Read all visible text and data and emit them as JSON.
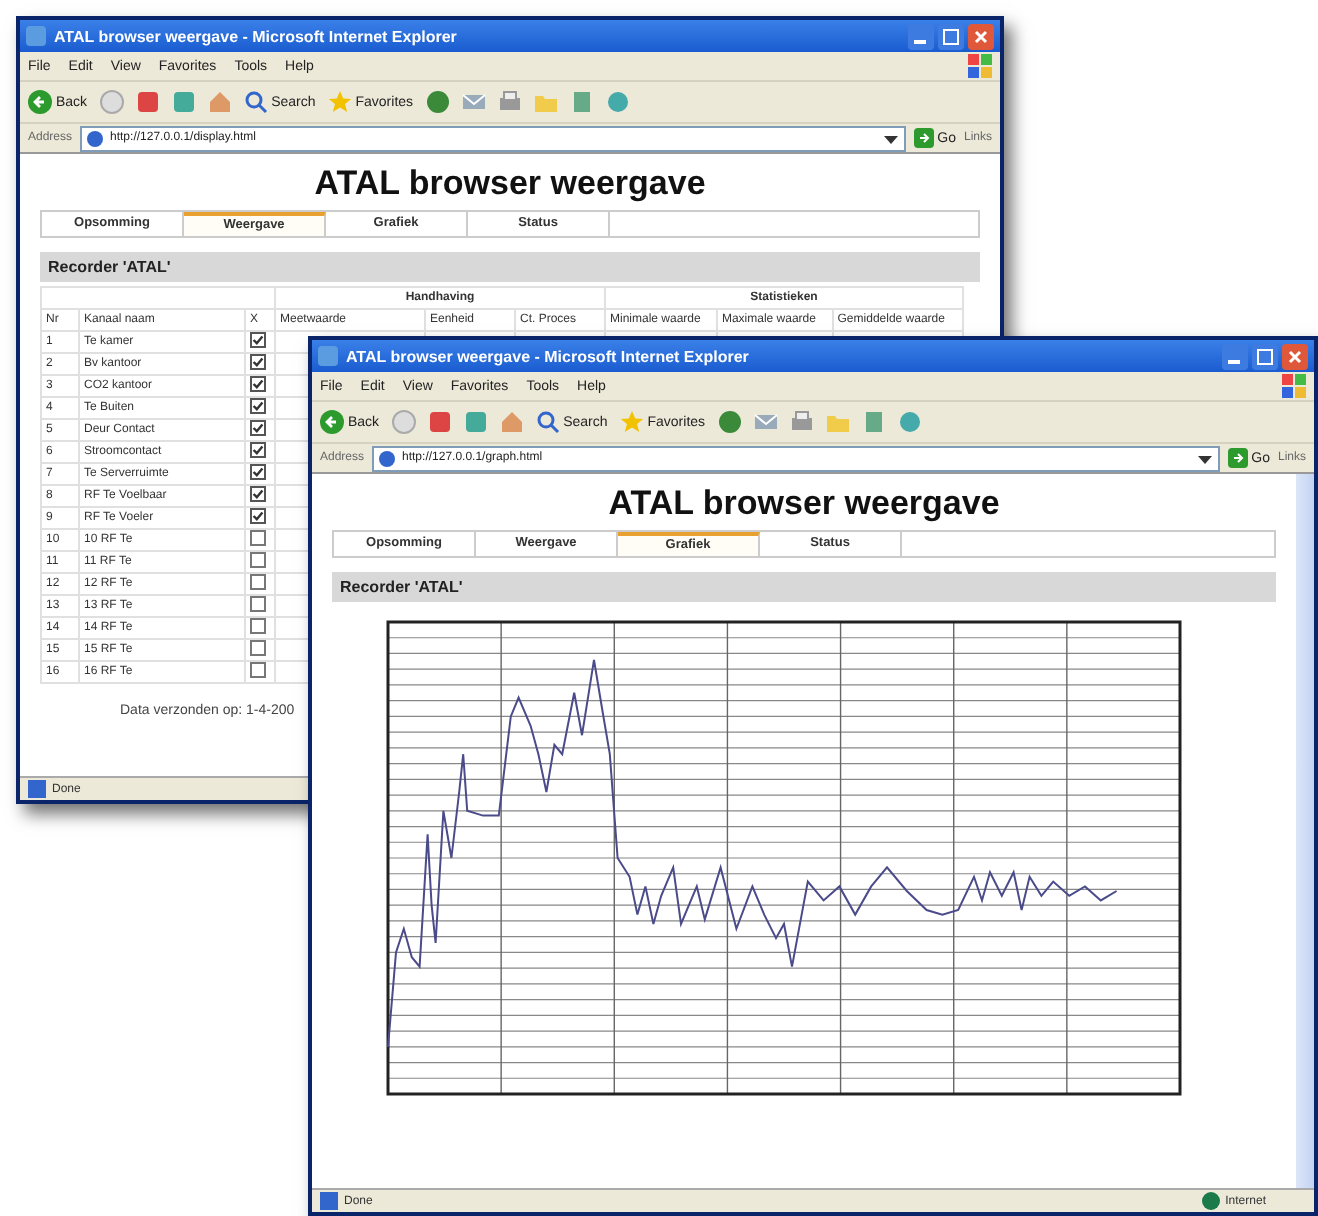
{
  "windows": [
    {
      "kind": "table",
      "title": "ATAL browser weergave - Microsoft Internet Explorer",
      "menu": [
        "File",
        "Edit",
        "View",
        "Favorites",
        "Tools",
        "Help"
      ],
      "toolbar": {
        "back": "Back",
        "search": "Search",
        "favorites": "Favorites"
      },
      "address": {
        "label": "Address",
        "url": "http://127.0.0.1/display.html",
        "go": "Go",
        "links": "Links"
      },
      "page": {
        "heading": "ATAL browser weergave",
        "tabs": [
          {
            "label": "Opsomming",
            "selected": false
          },
          {
            "label": "Weergave",
            "selected": true
          },
          {
            "label": "Grafiek",
            "selected": false
          },
          {
            "label": "Status",
            "selected": false
          }
        ],
        "section_title": "Recorder 'ATAL'",
        "table": {
          "groups": [
            "Handhaving",
            "Statistieken"
          ],
          "columns": [
            "Nr",
            "Kanaal naam",
            "X",
            "Meetwaarde",
            "Eenheid",
            "Ct. Proces",
            "Minimale waarde",
            "Maximale waarde",
            "Gemiddelde waarde"
          ],
          "rows": [
            {
              "nr": "1",
              "name": "Te kamer",
              "checked": true
            },
            {
              "nr": "2",
              "name": "Bv kantoor",
              "checked": true
            },
            {
              "nr": "3",
              "name": "CO2 kantoor",
              "checked": true
            },
            {
              "nr": "4",
              "name": "Te Buiten",
              "checked": true
            },
            {
              "nr": "5",
              "name": "Deur Contact",
              "checked": true
            },
            {
              "nr": "6",
              "name": "Stroomcontact",
              "checked": true
            },
            {
              "nr": "7",
              "name": "Te Serverruimte",
              "checked": true
            },
            {
              "nr": "8",
              "name": "RF Te Voelbaar",
              "checked": true
            },
            {
              "nr": "9",
              "name": "RF Te Voeler",
              "checked": true
            },
            {
              "nr": "10",
              "name": "10 RF Te",
              "checked": false
            },
            {
              "nr": "11",
              "name": "11 RF Te",
              "checked": false
            },
            {
              "nr": "12",
              "name": "12 RF Te",
              "checked": false
            },
            {
              "nr": "13",
              "name": "13 RF Te",
              "checked": false
            },
            {
              "nr": "14",
              "name": "14 RF Te",
              "checked": false
            },
            {
              "nr": "15",
              "name": "15 RF Te",
              "checked": false
            },
            {
              "nr": "16",
              "name": "16 RF Te",
              "checked": false
            }
          ]
        },
        "footer": "Data verzonden op: 1-4-200"
      },
      "status": "Done"
    },
    {
      "kind": "chart",
      "title": "ATAL browser weergave - Microsoft Internet Explorer",
      "menu": [
        "File",
        "Edit",
        "View",
        "Favorites",
        "Tools",
        "Help"
      ],
      "toolbar": {
        "back": "Back",
        "search": "Search",
        "favorites": "Favorites"
      },
      "address": {
        "label": "Address",
        "url": "http://127.0.0.1/graph.html",
        "go": "Go",
        "links": "Links"
      },
      "page": {
        "heading": "ATAL browser weergave",
        "tabs": [
          {
            "label": "Opsomming",
            "selected": false
          },
          {
            "label": "Weergave",
            "selected": false
          },
          {
            "label": "Grafiek",
            "selected": true
          },
          {
            "label": "Status",
            "selected": false
          }
        ],
        "section_title": "Recorder 'ATAL'"
      },
      "status": "Done",
      "zone": "Internet"
    }
  ]
}
